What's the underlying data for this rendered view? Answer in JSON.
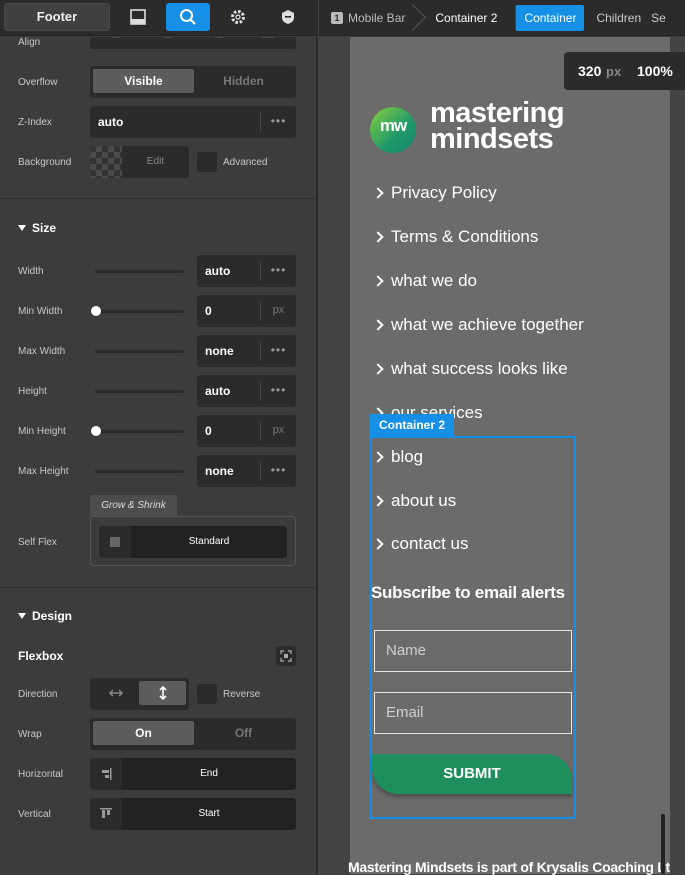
{
  "topbar": {
    "element_label": "Footer",
    "icons": [
      "layout-icon",
      "search-icon",
      "gear-icon",
      "shield-icon"
    ],
    "breadcrumb": [
      {
        "num": "1",
        "label": "Mobile Bar"
      },
      {
        "label": "Container 2"
      }
    ],
    "tabs": [
      "Container",
      "Children",
      "Se"
    ]
  },
  "panel": {
    "align_label": "Align",
    "overflow": {
      "label": "Overflow",
      "options": [
        "Visible",
        "Hidden"
      ],
      "selected": "Visible"
    },
    "zindex": {
      "label": "Z-Index",
      "value": "auto"
    },
    "background": {
      "label": "Background",
      "edit": "Edit",
      "advanced": "Advanced"
    },
    "size": {
      "title": "Size",
      "width": {
        "label": "Width",
        "value": "auto"
      },
      "min_width": {
        "label": "Min Width",
        "value": "0",
        "unit": "px"
      },
      "max_width": {
        "label": "Max Width",
        "value": "none"
      },
      "height": {
        "label": "Height",
        "value": "auto"
      },
      "min_height": {
        "label": "Min Height",
        "value": "0",
        "unit": "px"
      },
      "max_height": {
        "label": "Max Height",
        "value": "none"
      },
      "grow_tag": "Grow & Shrink",
      "self_flex": {
        "label": "Self Flex",
        "value": "Standard"
      }
    },
    "design": {
      "title": "Design",
      "flexbox": "Flexbox",
      "direction": {
        "label": "Direction",
        "reverse": "Reverse"
      },
      "wrap": {
        "label": "Wrap",
        "options": [
          "On",
          "Off"
        ],
        "selected": "On"
      },
      "horizontal": {
        "label": "Horizontal",
        "value": "End"
      },
      "vertical": {
        "label": "Vertical",
        "value": "Start"
      }
    }
  },
  "canvas": {
    "zoom": {
      "width": "320",
      "unit": "px",
      "percent": "100%"
    },
    "logo": {
      "mark": "mw",
      "line1": "mastering",
      "line2": "mindsets"
    },
    "menu": [
      "Privacy Policy",
      "Terms & Conditions",
      "what we do",
      "what we achieve together",
      "what success looks like",
      "our services",
      "blog",
      "about us",
      "contact us"
    ],
    "selected_tag": "Container 2",
    "subscribe_title": "Subscribe to email alerts",
    "name_placeholder": "Name",
    "email_placeholder": "Email",
    "submit": "SUBMIT",
    "footer_text": "Mastering Mindsets is part of Krysalis Coaching Ltd"
  },
  "colors": {
    "accent": "#1590e6",
    "brand_green": "#1e8e5c"
  }
}
